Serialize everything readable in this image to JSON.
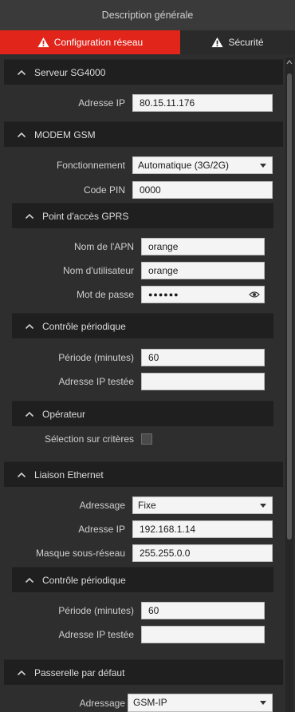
{
  "header": {
    "title": "Description générale"
  },
  "tabs": [
    {
      "label": "Configuration réseau",
      "icon": "warning-icon",
      "active": true,
      "color": "#e1251b"
    },
    {
      "label": "Sécurité",
      "icon": "warning-icon",
      "active": false
    }
  ],
  "sections": {
    "server": {
      "title": "Serveur SG4000",
      "ip_label": "Adresse IP",
      "ip_value": "80.15.11.176"
    },
    "modem": {
      "title": "MODEM GSM",
      "mode_label": "Fonctionnement",
      "mode_value": "Automatique (3G/2G)",
      "pin_label": "Code PIN",
      "pin_value": "0000",
      "gprs": {
        "title": "Point d'accès GPRS",
        "apn_label": "Nom de l'APN",
        "apn_value": "orange",
        "user_label": "Nom d'utilisateur",
        "user_value": "orange",
        "pass_label": "Mot de passe",
        "pass_value": "●●●●●●"
      },
      "periodic": {
        "title": "Contrôle périodique",
        "period_label": "Période (minutes)",
        "period_value": "60",
        "testip_label": "Adresse IP testée",
        "testip_value": ""
      },
      "operator": {
        "title": "Opérateur",
        "criteria_label": "Sélection sur critères",
        "criteria_checked": false
      }
    },
    "ethernet": {
      "title": "Liaison Ethernet",
      "addr_label": "Adressage",
      "addr_value": "Fixe",
      "ip_label": "Adresse IP",
      "ip_value": "192.168.1.14",
      "mask_label": "Masque sous-réseau",
      "mask_value": "255.255.0.0",
      "periodic": {
        "title": "Contrôle périodique",
        "period_label": "Période (minutes)",
        "period_value": "60",
        "testip_label": "Adresse IP testée",
        "testip_value": ""
      }
    },
    "gateway": {
      "title": "Passerelle par défaut",
      "addr_label": "Adressage",
      "addr_value": "GSM-IP"
    }
  }
}
